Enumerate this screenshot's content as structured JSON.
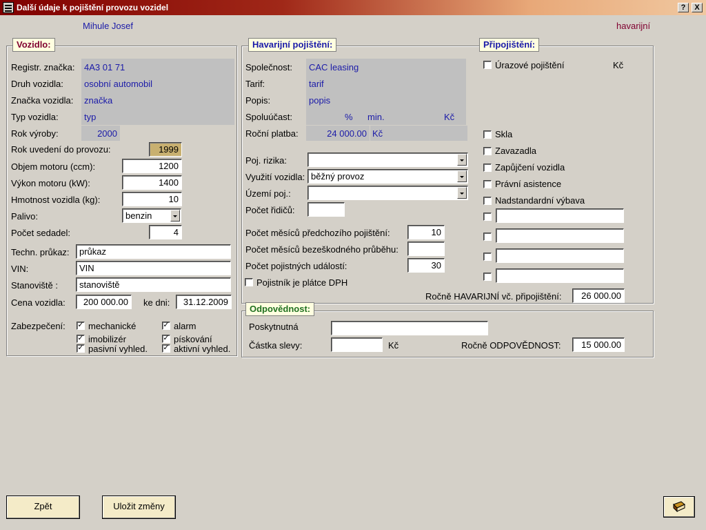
{
  "window": {
    "title": "Další údaje k pojištění provozu vozidel",
    "help_btn": "?",
    "close_btn": "X"
  },
  "header": {
    "client_name": "Mihule Josef",
    "insurance_type": "havarijní"
  },
  "vozidlo": {
    "title": "Vozidlo:",
    "regznacka_label": "Registr. značka:",
    "regznacka": "4A3 01 71",
    "druh_label": "Druh vozidla:",
    "druh": "osobní automobil",
    "znacka_label": "Značka vozidla:",
    "znacka": "značka",
    "typ_label": "Typ vozidla:",
    "typ": "typ",
    "rok_vyroby_label": "Rok výroby:",
    "rok_vyroby": "2000",
    "rok_uvedeni_label": "Rok uvedení do provozu:",
    "rok_uvedeni": "1999",
    "objem_label": "Objem motoru (ccm):",
    "objem": "1200",
    "vykon_label": "Výkon motoru (kW):",
    "vykon": "1400",
    "hmotnost_label": "Hmotnost vozidla (kg):",
    "hmotnost": "10",
    "palivo_label": "Palivo:",
    "palivo": "benzin",
    "sedadla_label": "Počet sedadel:",
    "sedadla": "4",
    "prukaz_label": "Techn. průkaz:",
    "prukaz": "průkaz",
    "vin_label": "VIN:",
    "vin": "VIN",
    "stanoviste_label": "Stanoviště :",
    "stanoviste": "stanoviště",
    "cena_label": "Cena vozidla:",
    "cena": "200 000.00",
    "kedni_label": "ke dni:",
    "kedni": "31.12.2009",
    "zabezpeceni_label": "Zabezpečení:",
    "zabezpeceni": [
      {
        "label": "mechanické",
        "checked": true
      },
      {
        "label": "alarm",
        "checked": true
      },
      {
        "label": "imobilizér",
        "checked": true
      },
      {
        "label": "pískování",
        "checked": true
      },
      {
        "label": "pasivní vyhled.",
        "checked": true
      },
      {
        "label": "aktivní vyhled.",
        "checked": true
      }
    ]
  },
  "havarijni": {
    "title": "Havarijní pojištění:",
    "spolecnost_label": "Společnost:",
    "spolecnost": "CAC leasing",
    "tarif_label": "Tarif:",
    "tarif": "tarif",
    "popis_label": "Popis:",
    "popis": "popis",
    "spoluucast_label": "Spoluúčast:",
    "pct": "%",
    "min": "min.",
    "kc": "Kč",
    "platba_label": "Roční platba:",
    "platba": "24 000.00",
    "platba_kc": "Kč",
    "rizika_label": "Poj. rizika:",
    "rizika": "",
    "vyuziti_label": "Využití vozidla:",
    "vyuziti": "běžný provoz",
    "uzemi_label": "Území poj.:",
    "uzemi": "",
    "ridici_label": "Počet řidičů:",
    "ridici": "",
    "mesice_pred_label": "Počet měsíců předchozího pojištění:",
    "mesice_pred": "10",
    "mesice_bez_label": "Počet měsíců bezeškodného průběhu:",
    "mesice_bez": "",
    "udalosti_label": "Počet pojistných událostí:",
    "udalosti": "30",
    "dph_label": "Pojistník je plátce DPH",
    "dph_checked": false
  },
  "pripojisteni": {
    "title": "Připojištění:",
    "urazove_label": "Úrazové pojištění",
    "urazove_kc": "Kč",
    "items": [
      {
        "label": "Skla"
      },
      {
        "label": "Zavazadla"
      },
      {
        "label": "Zapůjčení vozidla"
      },
      {
        "label": "Právní asistence"
      },
      {
        "label": "Nadstandardní výbava"
      }
    ],
    "rocne_label": "Ročně HAVARIJNÍ vč. připojištění:",
    "rocne": "26 000.00"
  },
  "odpovednost": {
    "title": "Odpovědnost:",
    "poskytnutna_label": "Poskytnutná",
    "poskytnutna": "",
    "sleva_label": "Částka slevy:",
    "sleva": "",
    "sleva_kc": "Kč",
    "rocne_label": "Ročně ODPOVĚDNOST:",
    "rocne": "15 000.00"
  },
  "buttons": {
    "zpet": "Zpět",
    "ulozit": "Uložit změny"
  },
  "colors": {
    "label_blue": "#1a1aa8",
    "group_title_bg": "#ffffe0",
    "button_bg": "#f4ebc8",
    "highlight_field": "#c8b070"
  }
}
